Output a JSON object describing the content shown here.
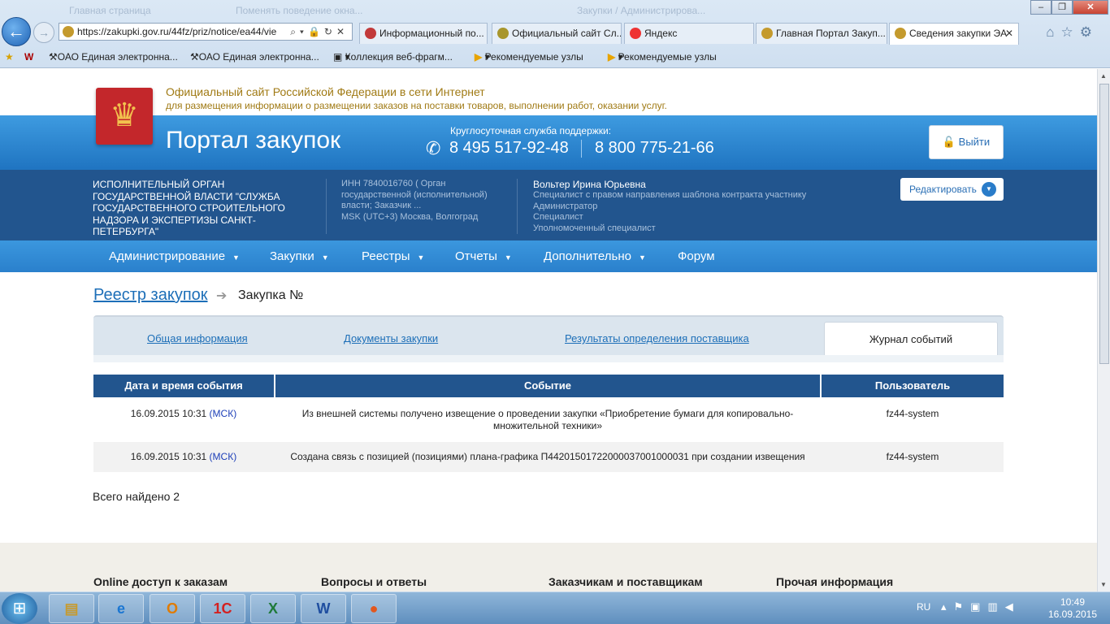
{
  "browser": {
    "address": "https://zakupki.gov.ru/44fz/priz/notice/ea44/vie",
    "tabs": [
      "Информационный по...",
      "Официальный сайт Сл...",
      "Яндекс",
      "Главная Портал Закуп...",
      "Сведения закупки ЭА"
    ],
    "faint_tabs": [
      "Главная страница",
      "Поменять поведение окна...",
      "Закупки / Администрирова..."
    ],
    "favorites": [
      "ОАО Единая электронна...",
      "ОАО Единая электронна...",
      "Коллекция веб-фрагм...",
      "Рекомендуемые узлы",
      "Рекомендуемые узлы"
    ]
  },
  "site": {
    "title_line1": "Официальный сайт Российской Федерации в сети Интернет",
    "title_line2": "для размещения информации о размещении заказов на поставки товаров, выполнении работ, оказании услуг.",
    "portal_name": "Портал закупок",
    "support_label": "Круглосуточная служба поддержки:",
    "phone1": "8 495 517-92-48",
    "phone2": "8 800 775-21-66",
    "logout": "Выйти"
  },
  "org": {
    "name": "ИСПОЛНИТЕЛЬНЫЙ ОРГАН ГОСУДАРСТВЕННОЙ ВЛАСТИ \"СЛУЖБА ГОСУДАРСТВЕННОГО СТРОИТЕЛЬНОГО НАДЗОРА И ЭКСПЕРТИЗЫ САНКТ-ПЕТЕРБУРГА\"",
    "inn_info": "ИНН 7840016760 ( Орган государственной (исполнительной) власти; Заказчик ...",
    "timezone": "MSK (UTC+3) Москва, Волгоград",
    "user_name": "Вольтер Ирина Юрьевна",
    "roles": [
      "Специалист с правом направления шаблона контракта участнику",
      "Администратор",
      "Специалист",
      "Уполномоченный специалист"
    ],
    "edit_button": "Редактировать"
  },
  "menu": [
    "Администрирование",
    "Закупки",
    "Реестры",
    "Отчеты",
    "Дополнительно",
    "Форум"
  ],
  "breadcrumb": {
    "root": "Реестр закупок",
    "current": "Закупка №"
  },
  "page_tabs": [
    "Общая информация",
    "Документы закупки",
    "Результаты определения поставщика",
    "Журнал событий"
  ],
  "table": {
    "headers": [
      "Дата и время события",
      "Событие",
      "Пользователь"
    ],
    "rows": [
      {
        "date": "16.09.2015 10:31",
        "tz": "(МСК)",
        "event_line1": "Из внешней системы получено извещение о проведении закупки «Приобретение бумаги для копировально-",
        "event_line2": "множительной техники»",
        "user": "fz44-system"
      },
      {
        "date": "16.09.2015 10:31",
        "tz": "(МСК)",
        "event_line1": "Создана связь с позицией (позициями) плана-графика П44201501722000037001000031 при создании извещения",
        "event_line2": "",
        "user": "fz44-system"
      }
    ]
  },
  "total": "Всего найдено 2",
  "footer": [
    "Online доступ к заказам",
    "Вопросы и ответы",
    "Заказчикам и поставщикам",
    "Прочая информация"
  ],
  "taskbar": {
    "lang": "RU",
    "time": "10:49",
    "date": "16.09.2015"
  }
}
